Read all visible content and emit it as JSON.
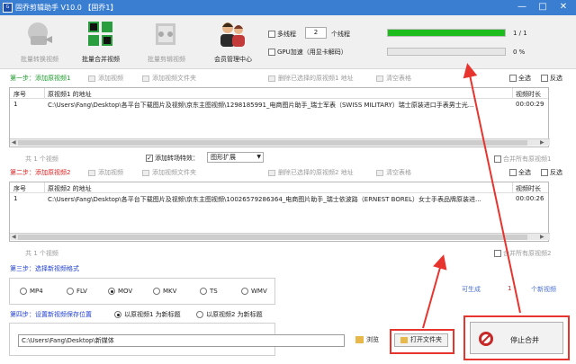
{
  "window": {
    "title": "固乔剪辑助手 V10.0 【固乔1】",
    "icon_text": "Ｇ",
    "minimize": "—",
    "maximize": "□",
    "close": "✕"
  },
  "toolbar": {
    "batch_convert": "批量转换视频",
    "batch_merge": "批量合并视频",
    "batch_split": "批量剪辑视频",
    "member_center": "会员管理中心"
  },
  "options": {
    "multithread_label": "多线程",
    "thread_count": "2",
    "thread_unit": "个线程",
    "gpu_label": "GPU加速（用显卡解码）"
  },
  "progress": {
    "bar1_fraction": 1.0,
    "bar1_text": "1 / 1",
    "bar2_fraction": 0.0,
    "bar2_text": "0 %",
    "bar1_color": "#1ebd1e"
  },
  "step1": {
    "label": "第一步：添加原视频1",
    "add_video": "添加视频",
    "add_folder": "添加视频文件夹",
    "delete_selected": "删除已选择的原视频1 地址",
    "clear_table": "清空表格",
    "select_all": "全选",
    "invert": "反选",
    "columns": [
      "序号",
      "原视频1 的地址",
      "视频时长"
    ],
    "rows": [
      {
        "index": "1",
        "path": "C:\\Users\\Fang\\Desktop\\各平台下载图片及视频\\京东主图视频\\1298185991_电商图片助手_瑞士军表（SWISS MILITARY）瑞士原装进口手表男士光...",
        "duration": "00:00:29"
      }
    ],
    "count": "共 1 个视频",
    "transition_label": "添加转场特效：",
    "transition_value": "图形扩展",
    "merge_all": "合并所有原视频1"
  },
  "step2": {
    "label": "第二步：添加原视频2",
    "add_video": "添加视频",
    "add_folder": "添加视频文件夹",
    "delete_selected": "删除已选择的原视频2 地址",
    "clear_table": "清空表格",
    "select_all": "全选",
    "invert": "反选",
    "columns": [
      "序号",
      "原视频2 的地址",
      "视频时长"
    ],
    "rows": [
      {
        "index": "1",
        "path": "C:\\Users\\Fang\\Desktop\\各平台下载图片及视频\\京东主图视频\\10026579286364_电商图片助手_瑞士依波路（ERNEST BOREL）女士手表品牌原装进...",
        "duration": "00:00:26"
      }
    ],
    "count": "共 1 个视频",
    "merge_all": "合并所有原视频2"
  },
  "step3": {
    "label": "第三步：选择新视频格式",
    "formats": [
      "MP4",
      "FLV",
      "MOV",
      "MKV",
      "TS",
      "WMV"
    ],
    "selected": "MOV",
    "generated_label": "可生成",
    "generated_count": "1",
    "generated_unit": "个新视频"
  },
  "step4": {
    "label": "第四步：设置新视频保存位置",
    "name_opt1": "以原视频1 为新标题",
    "name_opt2": "以原视频2 为新标题",
    "save_path": "C:\\Users\\Fang\\Desktop\\新媒体",
    "browse": "浏览",
    "open_folder": "打开文件夹"
  },
  "stop_button": "停止合并",
  "colors": {
    "title_bar": "#3a7ed1",
    "step_red": "#d22222",
    "step_blue": "#1f3fd0",
    "annotation": "#e8342e"
  }
}
